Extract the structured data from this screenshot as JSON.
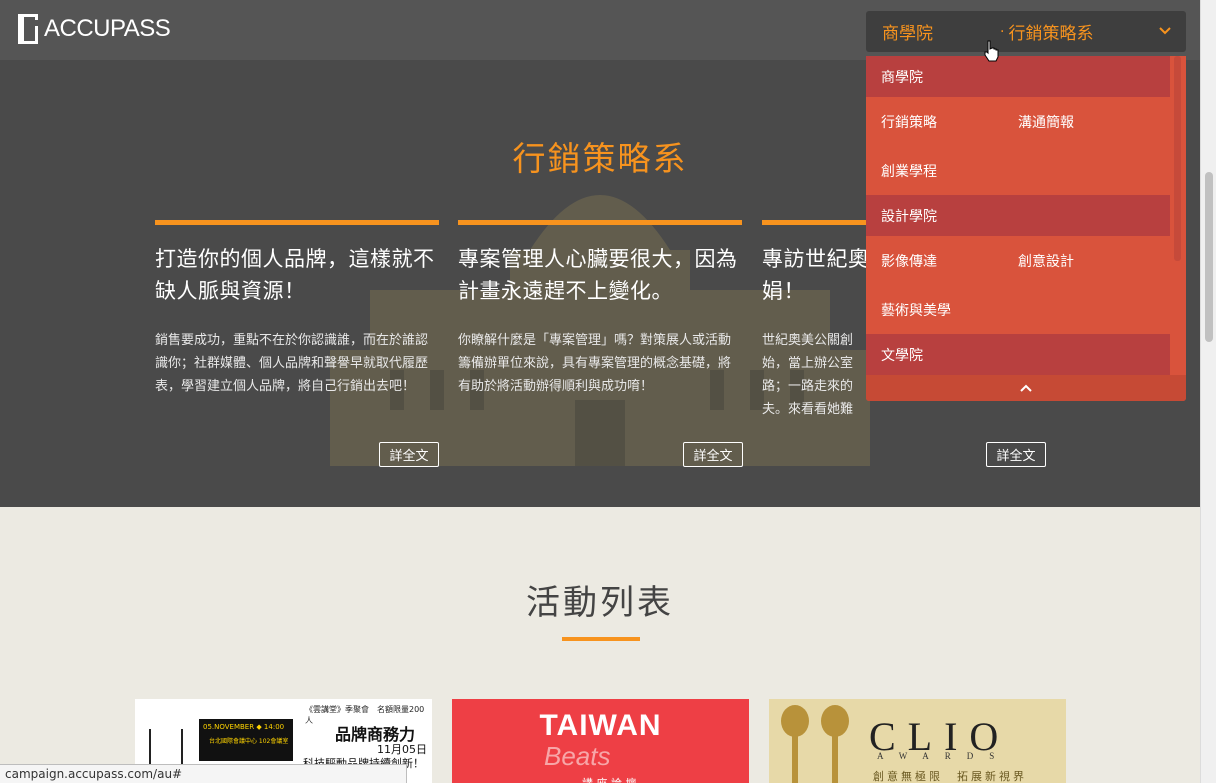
{
  "brand": {
    "logo_text": "ACCUPASS"
  },
  "header": {
    "dept_select": {
      "school": "商學院",
      "separator": "·",
      "department": "行銷策略系"
    }
  },
  "hero": {
    "title": "行銷策略系",
    "articles": [
      {
        "title": "打造你的個人品牌，這樣就不缺人脈與資源！",
        "excerpt": "銷售要成功，重點不在於你認識誰，而在於誰認識你；社群媒體、個人品牌和聲譽早就取代履歷表，學習建立個人品牌，將自己行銷出去吧！",
        "button": "詳全文"
      },
      {
        "title": "專案管理人心臟要很大，因為計畫永遠趕不上變化。",
        "excerpt": "你瞭解什麼是「專案管理」嗎？對策展人或活動籌備辦單位來說，具有專案管理的概念基礎，將有助於將活動辦得順利與成功唷！",
        "button": "詳全文"
      },
      {
        "title": "專訪世紀奧",
        "title_line2": "娟！",
        "excerpt_lines": [
          "世紀奧美公關創",
          "始，當上辦公室",
          "路；一路走來的",
          "夫。來看看她難"
        ],
        "button": "詳全文"
      }
    ]
  },
  "dropdown": {
    "groups": [
      {
        "school": "商學院",
        "departments": [
          [
            "行銷策略",
            "溝通簡報"
          ],
          [
            "創業學程"
          ]
        ]
      },
      {
        "school": "設計學院",
        "departments": [
          [
            "影像傳達",
            "創意設計"
          ],
          [
            "藝術與美學"
          ]
        ]
      },
      {
        "school": "文學院",
        "departments": []
      }
    ],
    "collapse_icon": "chevron-up-icon"
  },
  "events_section": {
    "title": "活動列表",
    "events": [
      {
        "tag": "《雲講堂》季聚會　名額限量200人",
        "title": "品牌商務力",
        "date": "11月05日",
        "subtitle": "科技驅動品牌持續創新！",
        "box_date": "05.NOVEMBER ◆ 14:00",
        "box_venue": "台北國際會議中心 102會議室"
      },
      {
        "title": "TAIWAN",
        "subtitle": "Beats",
        "footer": "講 座 論 壇"
      },
      {
        "title": "CLIO",
        "subtitle": "AWARDS",
        "tagline": "創意無極限　拓展新視界"
      }
    ]
  },
  "status_bar": {
    "url": "campaign.accupass.com/au#"
  },
  "colors": {
    "accent": "#f7931e",
    "menu": "#d9533c",
    "menu_school": "#b8403f",
    "hero_bg": "#4a4a4a",
    "lower_bg": "#eceae2"
  }
}
